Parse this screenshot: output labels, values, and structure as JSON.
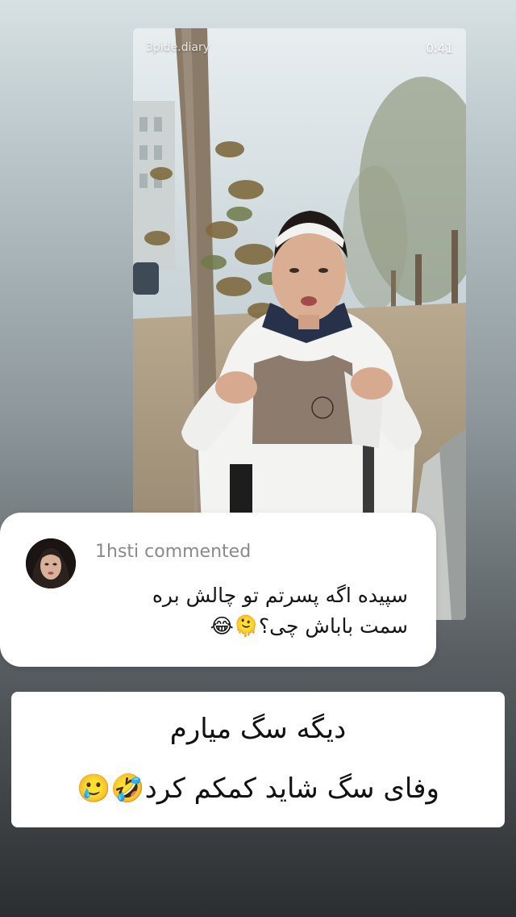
{
  "video": {
    "handle": "3pide.diary",
    "timestamp": "0:41"
  },
  "comment": {
    "username": "1hsti",
    "action": "commented",
    "text_line1": "سپیده اگه پسرتم تو چالش بره",
    "text_line2": "سمت باباش چی؟🫠😂"
  },
  "caption": {
    "line1": "دیگه سگ میارم",
    "line2": "وفای سگ شاید کمکم کرد🤣🥲"
  },
  "colors": {
    "sticker_bg": "#ffffff",
    "comment_meta": "#8a8a8a",
    "text": "#111111"
  }
}
